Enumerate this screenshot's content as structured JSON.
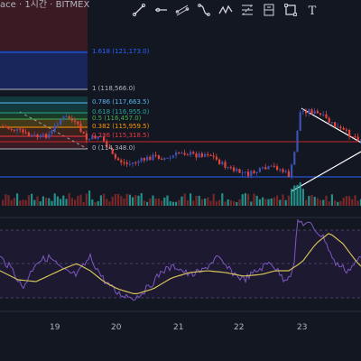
{
  "header": {
    "title": "ace · 1시간 · BITMEX"
  },
  "toolbar": {
    "tools": [
      {
        "name": "trend-line-icon"
      },
      {
        "name": "horizontal-ray-icon"
      },
      {
        "name": "parallel-channel-icon"
      },
      {
        "name": "path-icon"
      },
      {
        "name": "xabcd-pattern-icon"
      },
      {
        "name": "fib-retracement-icon"
      },
      {
        "name": "long-position-icon"
      },
      {
        "name": "rectangle-icon"
      },
      {
        "name": "text-icon"
      }
    ]
  },
  "fib_levels": [
    {
      "ratio": "1.618",
      "price": "121,173.0",
      "color": "#2962ff"
    },
    {
      "ratio": "1",
      "price": "118,566.0",
      "color": "#b2b5be"
    },
    {
      "ratio": "0.786",
      "price": "117,663.5",
      "color": "#5bb5f0"
    },
    {
      "ratio": "0.618",
      "price": "116,955.0",
      "color": "#26a69a"
    },
    {
      "ratio": "0.5",
      "price": "116,457.0",
      "color": "#4caf50"
    },
    {
      "ratio": "0.382",
      "price": "115,959.5",
      "color": "#ff9800"
    },
    {
      "ratio": "0.236",
      "price": "115,318.5",
      "color": "#f23645"
    },
    {
      "ratio": "0",
      "price": "114,348.0",
      "color": "#b2b5be"
    }
  ],
  "x_axis": {
    "labels": [
      "19",
      "20",
      "21",
      "22",
      "23"
    ]
  },
  "colors": {
    "background": "#131722",
    "up": "#3f51b5",
    "down": "#e5443b",
    "oscillator": "#7e57c2",
    "signal": "#d4c15a",
    "level_line": "#2962ff"
  }
}
